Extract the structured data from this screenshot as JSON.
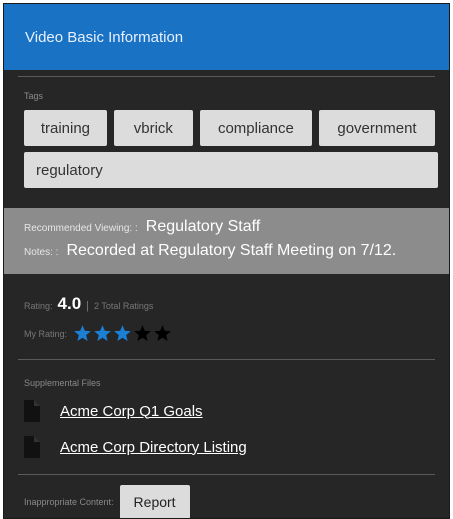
{
  "header": {
    "title": "Video Basic Information"
  },
  "tags": {
    "label": "Tags",
    "items": [
      "training",
      "vbrick",
      "compliance",
      "government",
      "regulatory"
    ]
  },
  "recommendation": {
    "viewing_label": "Recommended Viewing: :",
    "viewing_value": "Regulatory Staff",
    "notes_label": "Notes: :",
    "notes_value": "Recorded at Regulatory Staff Meeting on 7/12."
  },
  "rating": {
    "label": "Rating:",
    "value": "4.0",
    "separator": "|",
    "count_text": "2 Total Ratings",
    "my_rating_label": "My Rating:",
    "my_rating_stars": 3,
    "max_stars": 5,
    "star_active_color": "#1c7fd6",
    "star_inactive_color": "#000000"
  },
  "supplemental": {
    "label": "Supplemental Files",
    "files": [
      {
        "name": "Acme Corp Q1 Goals",
        "icon": "document-icon"
      },
      {
        "name": "Acme Corp Directory Listing",
        "icon": "document-icon"
      }
    ]
  },
  "inappropriate": {
    "label": "Inappropriate Content:",
    "button_label": "Report"
  },
  "colors": {
    "header_bg": "#1a72c4",
    "panel_bg": "#262626",
    "band_bg": "#8c8c8c"
  }
}
